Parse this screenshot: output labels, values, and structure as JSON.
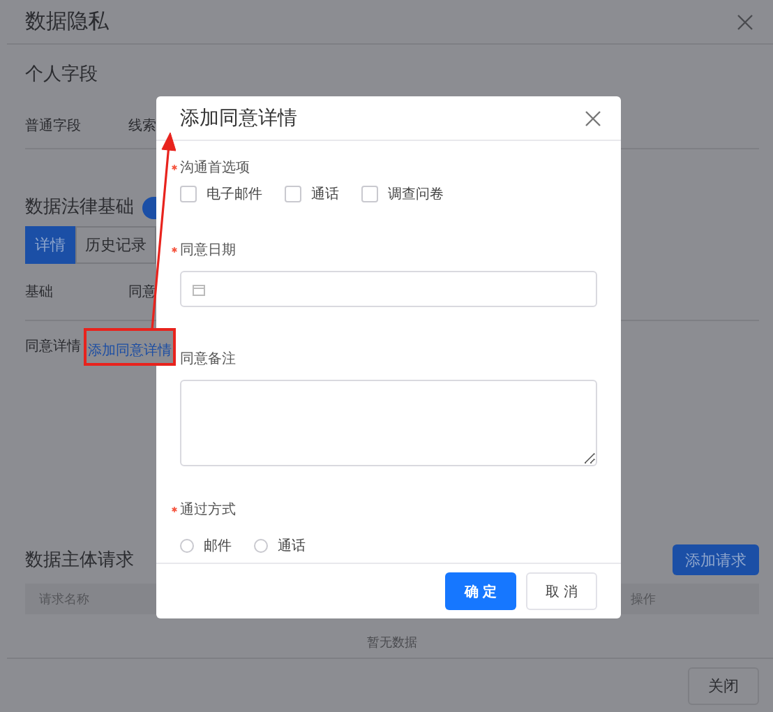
{
  "window": {
    "title": "数据隐私"
  },
  "personal_fields": {
    "heading": "个人字段",
    "label": "普通字段",
    "value": "线索"
  },
  "legal_basis": {
    "heading": "数据法律基础",
    "toggle_on": true,
    "tabs": [
      {
        "label": "详情",
        "selected": true
      },
      {
        "label": "历史记录",
        "selected": false
      }
    ],
    "rows": [
      {
        "label": "基础",
        "value": "同意",
        "kind": "text"
      },
      {
        "label": "同意详情",
        "value": "添加同意详情",
        "kind": "link"
      }
    ]
  },
  "subject_requests": {
    "heading": "数据主体请求",
    "add_button": "添加请求",
    "columns": [
      "请求名称",
      "操作"
    ],
    "empty_text": "暂无数据"
  },
  "footer": {
    "close_button": "关闭"
  },
  "dialog": {
    "title": "添加同意详情",
    "fields": [
      {
        "kind": "checkboxes",
        "label": "沟通首选项",
        "required": true,
        "options": [
          {
            "label": "电子邮件",
            "checked": false
          },
          {
            "label": "通话",
            "checked": false
          },
          {
            "label": "调查问卷",
            "checked": false
          }
        ]
      },
      {
        "kind": "date",
        "label": "同意日期",
        "required": true
      },
      {
        "kind": "textarea",
        "label": "同意备注",
        "required": false
      },
      {
        "kind": "radios",
        "label": "通过方式",
        "required": true,
        "options": [
          {
            "label": "邮件",
            "selected": false
          },
          {
            "label": "通话",
            "selected": false
          }
        ]
      }
    ],
    "ok_button": "确 定",
    "cancel_button": "取 消"
  }
}
